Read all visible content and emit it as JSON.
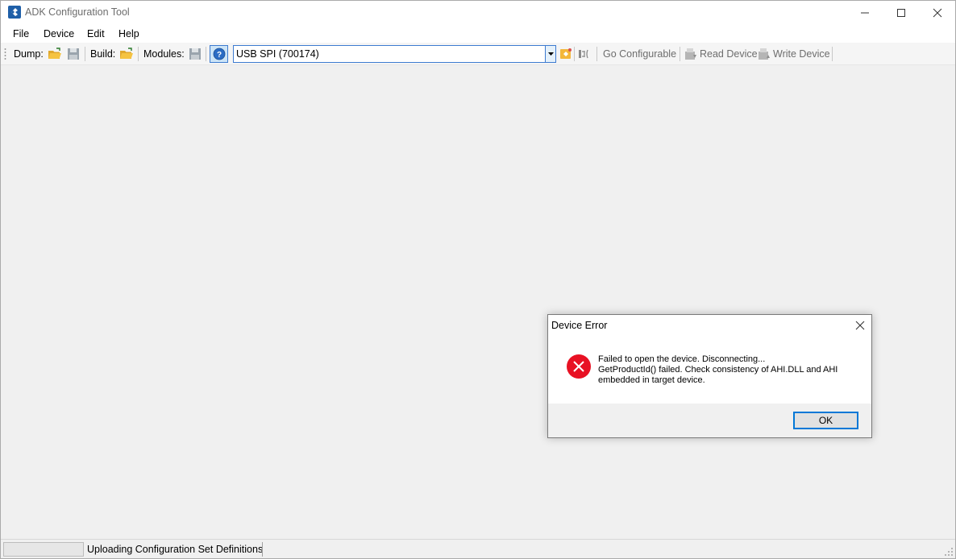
{
  "window": {
    "title": "ADK Configuration Tool"
  },
  "menu": {
    "items": [
      "File",
      "Device",
      "Edit",
      "Help"
    ]
  },
  "toolbar": {
    "dump_label": "Dump:",
    "build_label": "Build:",
    "modules_label": "Modules:",
    "device_selected": "USB SPI (700174)",
    "go_configurable": "Go Configurable",
    "read_device": "Read Device",
    "write_device": "Write Device"
  },
  "statusbar": {
    "text": "Uploading Configuration Set Definitions",
    "progress": 0
  },
  "dialog": {
    "title": "Device Error",
    "message_lines": [
      "Failed to open the device. Disconnecting...",
      "GetProductId() failed. Check consistency of AHI.DLL and AHI",
      "embedded in target device."
    ],
    "ok_label": "OK"
  },
  "colors": {
    "accent": "#0078d7",
    "error_red": "#e81123",
    "folder_yellow": "#f5c342",
    "disabled_text": "#6d6d6d"
  }
}
